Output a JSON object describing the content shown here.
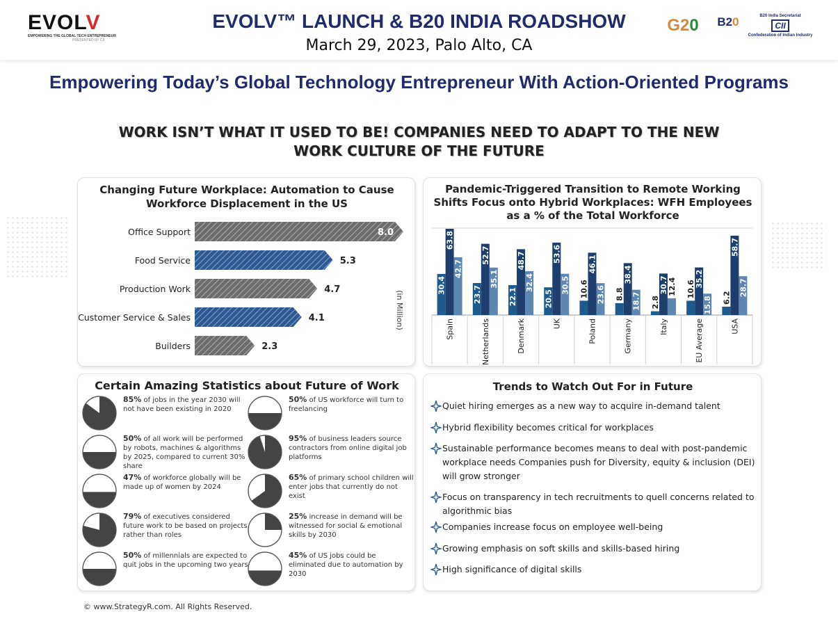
{
  "header": {
    "logo": {
      "word": "EVOLV",
      "tagline": "EMPOWERING THE GLOBAL TECH ENTREPRENEUR",
      "presented": "PRESENTED BY CII"
    },
    "title": "EVOLV™ LAUNCH & B20 INDIA ROADSHOW",
    "date": "March 29, 2023, Palo Alto, CA",
    "partners": {
      "g20": "G20",
      "b20": "B20",
      "cii_secretariat": "B20 India Secretariat",
      "cii": "CII",
      "cii_name": "Confederation of Indian Industry"
    }
  },
  "subtitle": "Empowering Today’s Global Technology Entrepreneur With Action-Oriented Programs",
  "headline": [
    "WORK ISN’T WHAT IT USED TO BE! COMPANIES NEED TO ADAPT TO THE NEW",
    "WORK CULTURE OF THE FUTURE"
  ],
  "chart_data": [
    {
      "type": "bar",
      "orientation": "horizontal",
      "title": "Changing Future Workplace: Automation to Cause Workforce Displacement in the US",
      "unit_label": "(in Million)",
      "categories": [
        "Office Support",
        "Food Service",
        "Production Work",
        "Customer Service & Sales",
        "Builders"
      ],
      "values": [
        8.0,
        5.3,
        4.7,
        4.1,
        2.3
      ],
      "value_labels": [
        "8.0",
        "5.3",
        "4.7",
        "4.1",
        "2.3"
      ],
      "highlight": [
        false,
        true,
        false,
        true,
        false
      ],
      "colors": {
        "gray": "#6d6d6d",
        "blue": "#2d5a94"
      }
    },
    {
      "type": "bar",
      "title": "Pandemic-Triggered Transition to Remote Working Shifts Focus onto Hybrid Workplaces: WFH Employees as a % of the Total Workforce",
      "categories": [
        "Spain",
        "Netherlands",
        "Denmark",
        "UK",
        "Poland",
        "Germany",
        "Italy",
        "EU Average",
        "USA"
      ],
      "series": [
        {
          "values": [
            30.4,
            23.7,
            22.1,
            20.5,
            10.6,
            8.8,
            2.8,
            10.6,
            6.2
          ],
          "labels": [
            "30.4",
            "23.7",
            "22.1",
            "20.5",
            "10.6",
            "8.8",
            "2.8",
            "10.6",
            "6.2"
          ]
        },
        {
          "values": [
            63.8,
            52.7,
            48.7,
            53.6,
            46.1,
            38.4,
            30.7,
            35.2,
            58.7
          ],
          "labels": [
            "63.8",
            "52.7",
            "48.7",
            "53.6",
            "46.1",
            "38.4",
            "30.7",
            "35.2",
            "58.7"
          ]
        },
        {
          "values": [
            42.7,
            35.1,
            32.4,
            30.5,
            23.6,
            18.7,
            12.4,
            15.8,
            28.7
          ],
          "labels": [
            "42.7",
            "35.1",
            "32.4",
            "30.5",
            "23.6",
            "18.7",
            "12.4",
            "15.8",
            "28.7"
          ]
        }
      ],
      "colors": [
        "#1f5a8f",
        "#1e3f6e",
        "#5e86b3"
      ]
    },
    {
      "type": "pie",
      "title": "Certain Amazing Statistics about Future of Work",
      "style": {
        "filled": "#444444",
        "empty": "#ffffff"
      },
      "items": [
        {
          "percent": 85,
          "kind": "pie",
          "bold": "85%",
          "text": "of jobs in the year 2030 will not have been existing in 2020"
        },
        {
          "percent": 50,
          "kind": "fill",
          "bold": "50%",
          "text": "of US workforce will turn to freelancing"
        },
        {
          "percent": 50,
          "kind": "fill",
          "bold": "50%",
          "text": "of all work will be performed by robots, machines & algorithms by 2025, compared to current 30% share"
        },
        {
          "percent": 95,
          "kind": "pie",
          "bold": "95%",
          "text": "of business leaders source contractors from online digital job platforms"
        },
        {
          "percent": 47,
          "kind": "fill",
          "bold": "47%",
          "text": "of workforce globally will be made up of women by 2024"
        },
        {
          "percent": 65,
          "kind": "pie",
          "bold": "65%",
          "text": "of primary school children will enter jobs that currently do not exist"
        },
        {
          "percent": 79,
          "kind": "pie",
          "bold": "79%",
          "text": "of executives considered future work to be based on projects rather than roles"
        },
        {
          "percent": 25,
          "kind": "pie",
          "bold": "25%",
          "text": "increase in demand will be witnessed for social & emotional skills by 2030"
        },
        {
          "percent": 50,
          "kind": "fill",
          "bold": "50%",
          "text": "of millennials are expected to quit jobs in the upcoming two years"
        },
        {
          "percent": 45,
          "kind": "fill",
          "bold": "45%",
          "text": "of US jobs could be eliminated due to automation by 2030"
        }
      ]
    }
  ],
  "trends": {
    "title": "Trends to Watch Out For in Future",
    "icon": "four-point-star-icon",
    "icon_color": "#2d5a94",
    "items": [
      "Quiet hiring emerges as a new way to acquire in-demand talent",
      "Hybrid flexibility becomes critical for workplaces",
      "Sustainable performance becomes means to deal with post-pandemic workplace needs Companies push for Diversity, equity & inclusion (DEI) will grow stronger",
      "Focus on transparency in tech recruitments to quell concerns related to algorithmic bias",
      "Companies increase focus on employee well-being",
      "Growing emphasis on soft skills and skills-based hiring",
      "High significance of digital skills"
    ]
  },
  "copyright": "© www.StrategyR.com. All Rights Reserved."
}
